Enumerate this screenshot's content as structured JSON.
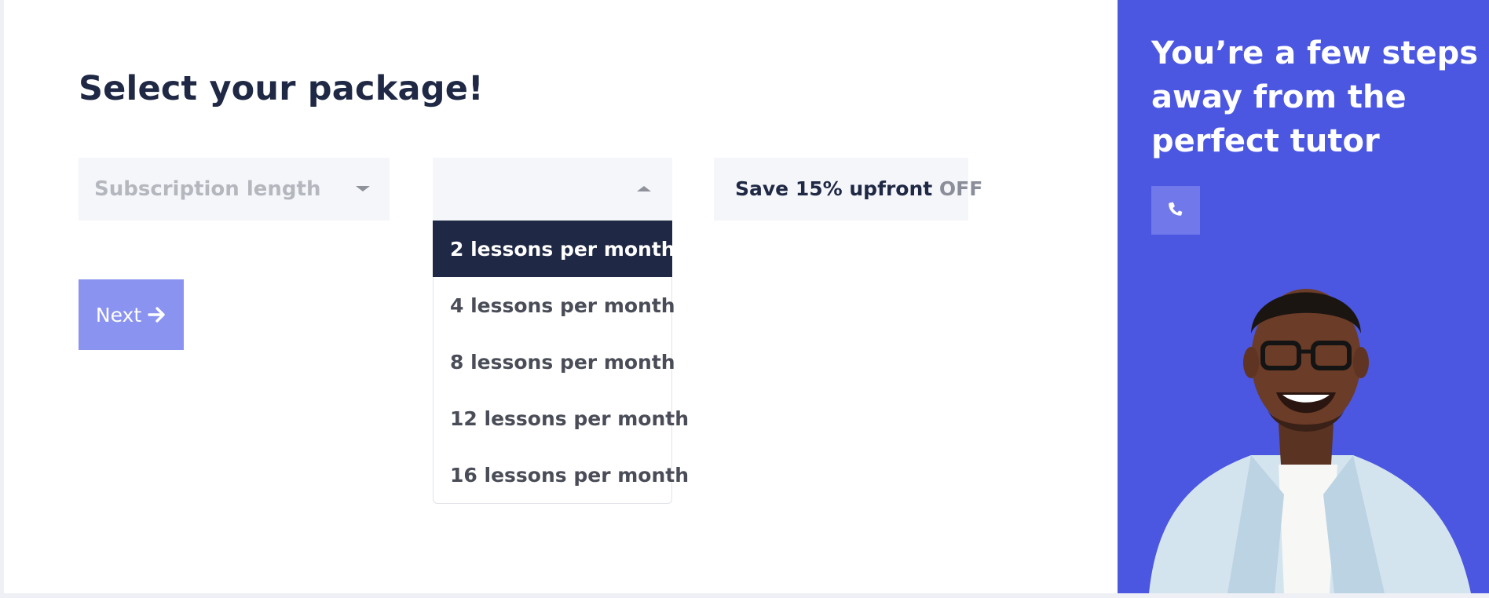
{
  "form": {
    "title": "Select your package!",
    "subscription": {
      "placeholder": "Subscription length",
      "icon": "caret-down-icon"
    },
    "lessons": {
      "value": "",
      "icon": "caret-up-icon",
      "options": [
        "2 lessons per month",
        "4 lessons per month",
        "8 lessons per month",
        "12 lessons per month",
        "16 lessons per month"
      ],
      "selected": "2 lessons per month"
    },
    "save": {
      "text": "Save 15% upfront",
      "suffix": "OFF"
    },
    "next_label": "Next",
    "next_icon": "arrow-right-icon"
  },
  "side": {
    "title": "You’re a few steps away from the perfect tutor",
    "phone_icon": "phone-icon",
    "image": "smiling-tutor-photo"
  },
  "colors": {
    "accent": "#4b57e0",
    "dark": "#1f2844",
    "button": "#8b93f0",
    "field_bg": "#f5f6fa"
  }
}
